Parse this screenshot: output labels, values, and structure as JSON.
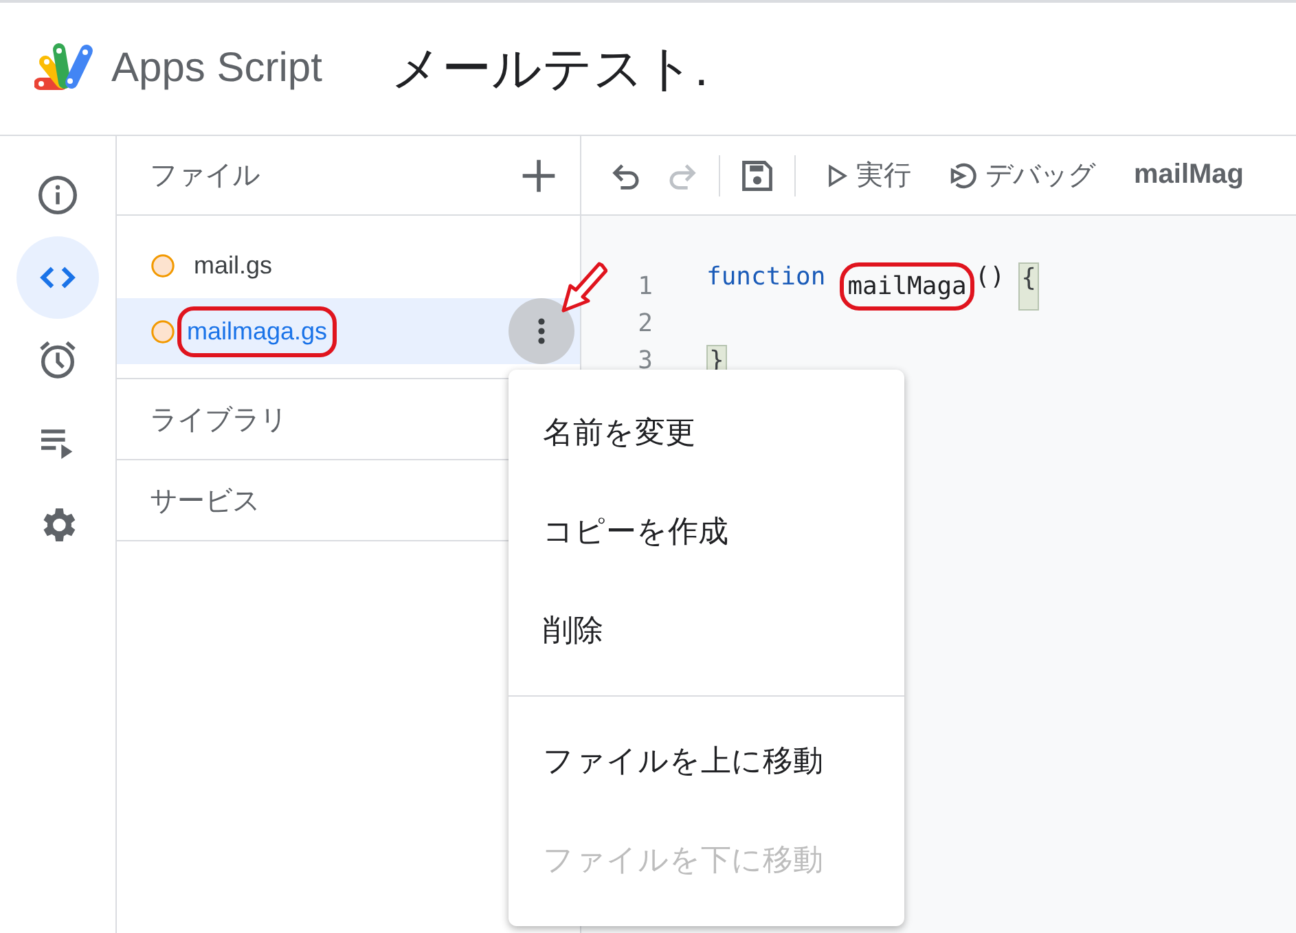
{
  "header": {
    "app_name": "Apps Script",
    "project_title": "メールテスト."
  },
  "rail": [
    {
      "kind": "info",
      "selected": false
    },
    {
      "kind": "code",
      "selected": true
    },
    {
      "kind": "alarm",
      "selected": false
    },
    {
      "kind": "executions",
      "selected": false
    },
    {
      "kind": "settings",
      "selected": false
    }
  ],
  "files_panel": {
    "title": "ファイル",
    "files": [
      {
        "name": "mail.gs",
        "selected": false,
        "annotated": false
      },
      {
        "name": "mailmaga.gs",
        "selected": true,
        "annotated": true
      }
    ],
    "sections": [
      "ライブラリ",
      "サービス"
    ]
  },
  "toolbar": {
    "undo_disabled": false,
    "redo_disabled": true,
    "run": "実行",
    "debug": "デバッグ",
    "function_name": "mailMag"
  },
  "editor": {
    "lines": [
      {
        "number": "1",
        "tokens": [
          {
            "kind": "keyword",
            "text": "function"
          },
          {
            "kind": "name",
            "text": "mailMaga",
            "annotated": true
          },
          {
            "kind": "plain",
            "text": "()"
          },
          {
            "kind": "bracket",
            "text": "{"
          }
        ]
      },
      {
        "number": "2"
      },
      {
        "number": "3",
        "tokens": [
          {
            "kind": "bracket",
            "text": "}"
          }
        ]
      }
    ]
  },
  "context_menu": [
    {
      "label": "名前を変更",
      "disabled": false,
      "divider_before": false
    },
    {
      "label": "コピーを作成",
      "disabled": false,
      "divider_before": false
    },
    {
      "label": "削除",
      "disabled": false,
      "divider_before": false
    },
    {
      "label": "ファイルを上に移動",
      "disabled": false,
      "divider_before": true
    },
    {
      "label": "ファイルを下に移動",
      "disabled": true,
      "divider_before": false
    }
  ]
}
